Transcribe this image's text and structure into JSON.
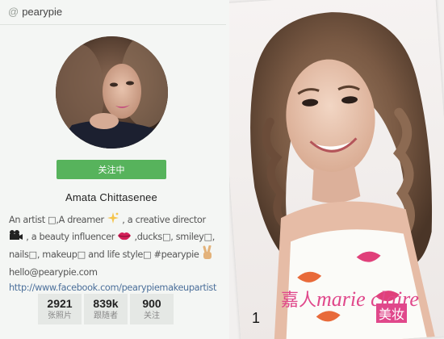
{
  "profile": {
    "handle": "pearypie",
    "follow_label": "关注中",
    "display_name": "Amata Chittasenee",
    "bio_lines": [
      {
        "segments": [
          "An artist ",
          "□",
          ",A dreamer ",
          "✨",
          " , a creative director"
        ]
      },
      {
        "segments": [
          "🎥",
          " , a beauty influencer ",
          "💋",
          " ,ducks",
          "□",
          ", smiley",
          "□",
          ","
        ]
      },
      {
        "segments": [
          "nails",
          "□",
          ", makeup",
          "□",
          " and life style",
          "□",
          " #pearypie ",
          "✌"
        ]
      }
    ],
    "email": "hello@pearypie.com",
    "url": "http://www.facebook.com/pearypiemakeupartist",
    "stats": [
      {
        "value": "2921",
        "label": "张照片"
      },
      {
        "value": "839k",
        "label": "跟随者"
      },
      {
        "value": "900",
        "label": "关注"
      }
    ]
  },
  "photo": {
    "number": "1",
    "logo_chinese_left": "嘉人",
    "logo_brand": "marie claire",
    "logo_chinese_right": "美妆"
  },
  "colors": {
    "follow_green": "#57b35c",
    "link_blue": "#4b6f9a",
    "logo_pink": "#e0488b"
  },
  "icons": {
    "at": "at-icon",
    "sparkle": "sparkle-emoji",
    "camera": "movie-camera-emoji",
    "lips": "kiss-mark-emoji",
    "victory": "victory-hand-emoji"
  }
}
